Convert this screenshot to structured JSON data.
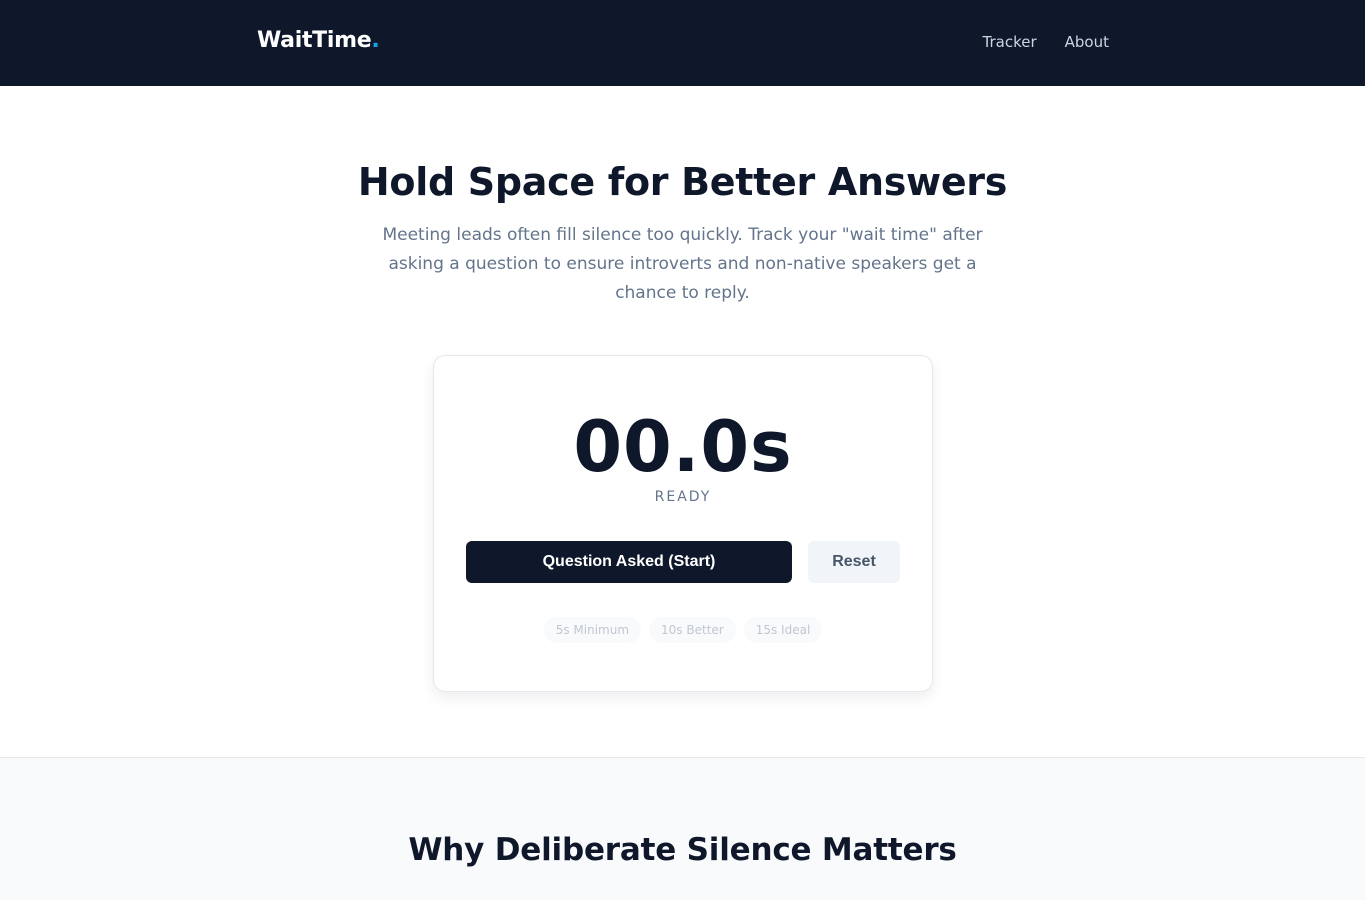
{
  "nav": {
    "brand": "WaitTime",
    "brand_dot": ".",
    "links": [
      "Tracker",
      "About"
    ]
  },
  "hero": {
    "title": "Hold Space for Better Answers",
    "subtitle": "Meeting leads often fill silence too quickly. Track your \"wait time\" after asking a question to ensure introverts and non-native speakers get a chance to reply."
  },
  "timer": {
    "display": "00.0s",
    "status": "READY",
    "start_label": "Question Asked (Start)",
    "reset_label": "Reset",
    "milestones": [
      "5s Minimum",
      "10s Better",
      "15s Ideal"
    ]
  },
  "why": {
    "title": "Why Deliberate Silence Matters"
  },
  "colors": {
    "navbar_bg": "#0f172a",
    "brand_accent": "#0ea5e9",
    "primary_button": "#0f172a",
    "secondary_button": "#f1f5f9"
  }
}
